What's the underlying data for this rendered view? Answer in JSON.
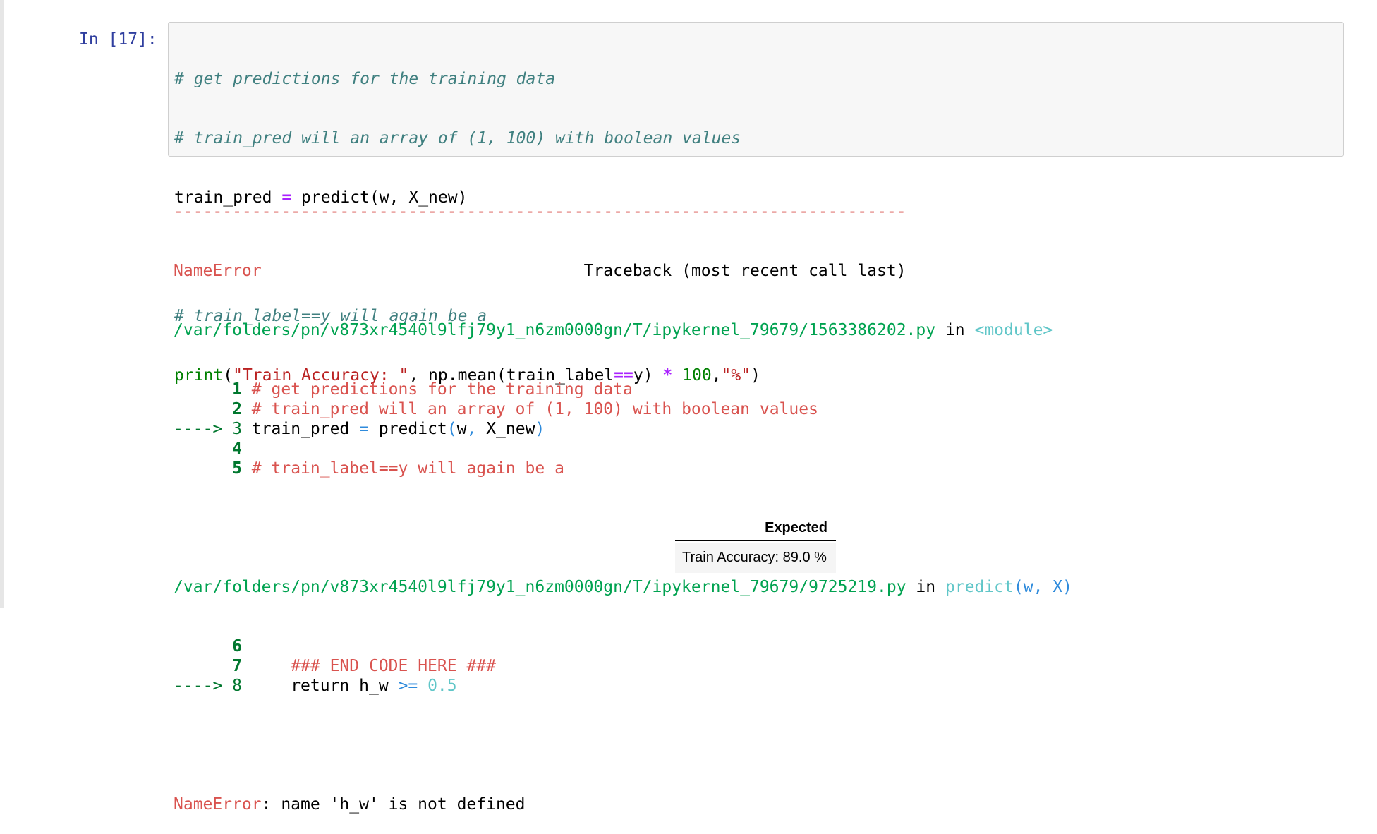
{
  "cell": {
    "prompt": "In [17]:",
    "code_lines": [
      "# get predictions for the training data",
      "# train_pred will an array of (1, 100) with boolean values",
      "train_pred = predict(w, X_new)",
      "",
      "# train_label==y will again be a",
      "print(\"Train Accuracy: \", np.mean(train_label==y) * 100,\"%\")"
    ]
  },
  "traceback": {
    "separator": "---------------------------------------------------------------------------",
    "error_name": "NameError",
    "header_right": "Traceback (most recent call last)",
    "frame1": {
      "path": "/var/folders/pn/v873xr4540l9lfj79y1_n6zm0000gn/T/ipykernel_79679/1563386202.py",
      "in_word": " in ",
      "func": "<module>",
      "lines": [
        {
          "marker": "      ",
          "num": "1",
          "code": " # get predictions for the training data"
        },
        {
          "marker": "      ",
          "num": "2",
          "code": " # train_pred will an array of (1, 100) with boolean values"
        },
        {
          "marker": "----> ",
          "num": "3",
          "code": " train_pred = predict(w, X_new)"
        },
        {
          "marker": "      ",
          "num": "4",
          "code": ""
        },
        {
          "marker": "      ",
          "num": "5",
          "code": " # train_label==y will again be a"
        }
      ]
    },
    "frame2": {
      "path": "/var/folders/pn/v873xr4540l9lfj79y1_n6zm0000gn/T/ipykernel_79679/9725219.py",
      "in_word": " in ",
      "func": "predict",
      "args": "(w, X)",
      "lines": [
        {
          "marker": "      ",
          "num": "6",
          "code": ""
        },
        {
          "marker": "      ",
          "num": "7",
          "code": "     ### END CODE HERE ###"
        },
        {
          "marker": "----> ",
          "num": "8",
          "code": "     return h_w >= 0.5"
        }
      ]
    },
    "final_error_name": "NameError",
    "final_message": ": name 'h_w' is not defined"
  },
  "expected": {
    "header": "Expected",
    "value": "Train Accuracy: 89.0 %"
  }
}
